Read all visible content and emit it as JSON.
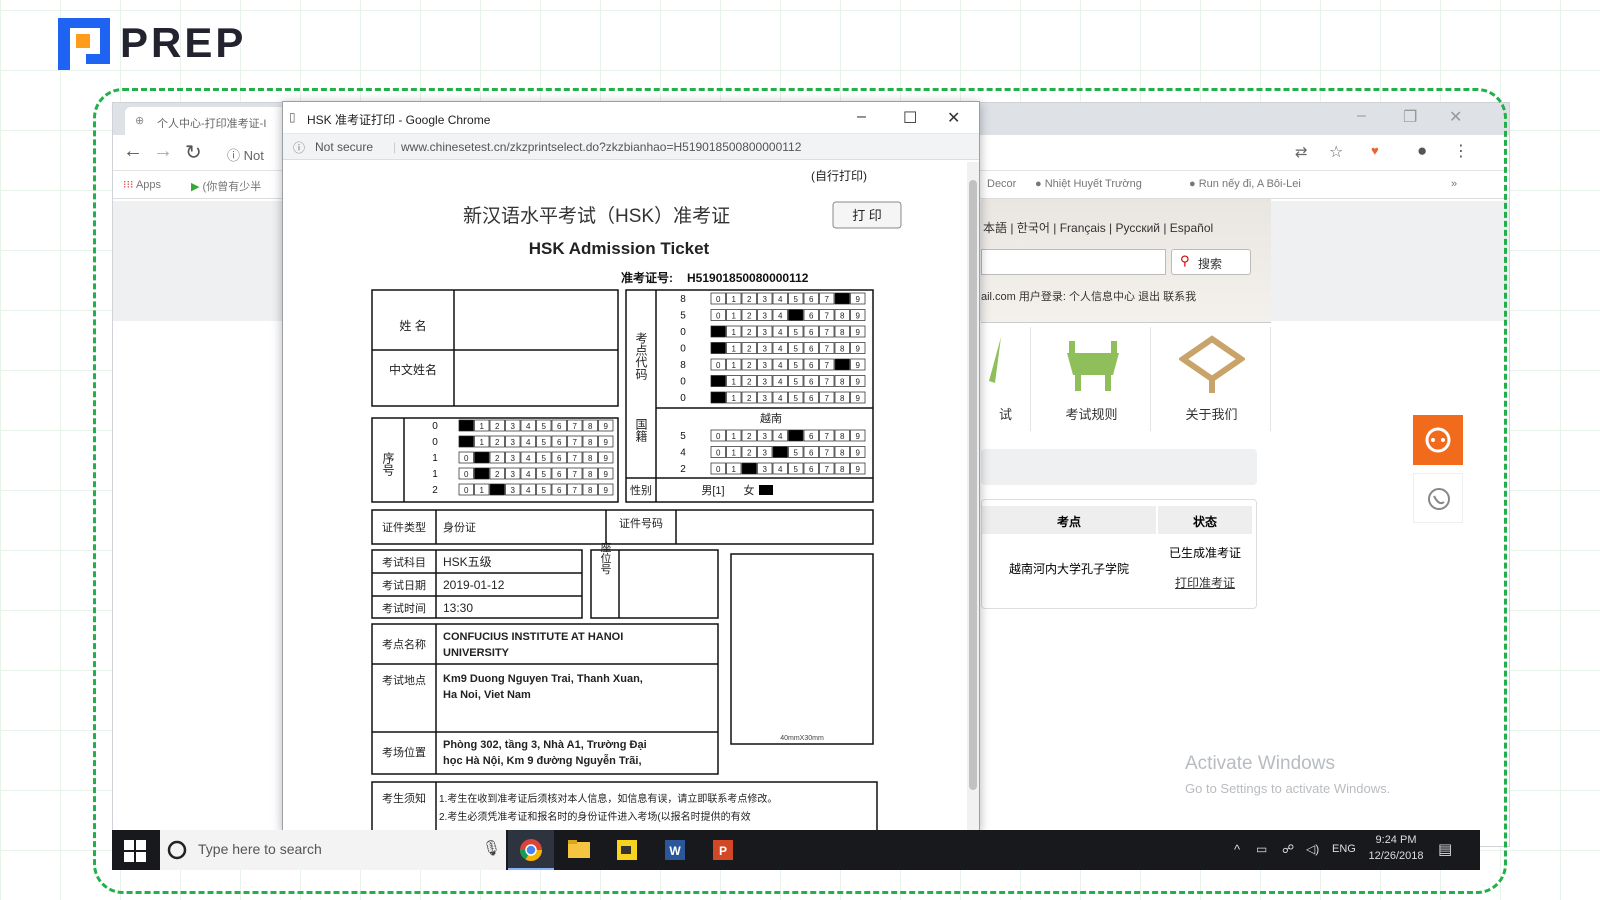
{
  "brand": {
    "name": "PREP",
    "colors": {
      "brand_blue": "#1f63f2",
      "brand_orange": "#ff9c1a",
      "dashed_green": "#22b04a"
    }
  },
  "bg_browser": {
    "tab_title": "个人中心-打印准考证-I",
    "address_text": "Not",
    "bookmarks": [
      "Apps",
      "(你曾有少半",
      "Decor",
      "Nhiệt Huyết Trường",
      "Run nếy đi, A Bôi-Lei"
    ],
    "languages": "本語 | 한국어 | Français | Русский | Español",
    "search_label": "搜索",
    "user_bar": "ail.com  用户登录: 个人信息中心  退出  联系我",
    "nav_tiles": [
      "试",
      "考试规则",
      "关于我们"
    ],
    "table_headers": [
      "考点",
      "状态"
    ],
    "table_row": {
      "center": "越南河内大学孔子学院",
      "status": "已生成准考证",
      "action": "打印准考证"
    },
    "activate_title": "Activate Windows",
    "activate_sub": "Go to Settings to activate Windows."
  },
  "popup": {
    "window_title": "HSK 准考证打印 - Google Chrome",
    "security": "Not secure",
    "url": "www.chinesetest.cn/zkzprintselect.do?zkzbianhao=H519018500800000112"
  },
  "ticket": {
    "self_print": "(自行打印)",
    "title_cn": "新汉语水平考试（HSK）准考证",
    "print_button": "打 印",
    "title_en": "HSK Admission Ticket",
    "number_label": "准考证号:",
    "number": "H51901850080000112",
    "name_label": "姓  名",
    "cn_name_label": "中文姓名",
    "seq_label": "序号",
    "seq_digits": [
      "0",
      "0",
      "1",
      "1",
      "2"
    ],
    "seq_marked": [
      0,
      0,
      1,
      1,
      2
    ],
    "center_code_label": "考点代码",
    "center_digits": [
      "8",
      "5",
      "0",
      "0",
      "8",
      "0",
      "0"
    ],
    "center_marked": [
      8,
      5,
      0,
      0,
      8,
      0,
      0
    ],
    "nationality_label": "国籍",
    "nationality": "越南",
    "nat_digits": [
      "5",
      "4",
      "2"
    ],
    "nat_marked": [
      5,
      4,
      2
    ],
    "gender_label": "性别",
    "gender_male": "男[1]",
    "gender_female": "女",
    "id_type_label": "证件类型",
    "id_type": "身份证",
    "id_number_label": "证件号码",
    "exam_subject_label": "考试科目",
    "exam_subject": "HSK五级",
    "exam_date_label": "考试日期",
    "exam_date": "2019-01-12",
    "exam_time_label": "考试时间",
    "exam_time": "13:30",
    "seat_label": "座位号",
    "photo_note": "40mmX30mm",
    "center_name_label": "考点名称",
    "center_name_line1": "CONFUCIUS INSTITUTE AT HANOI",
    "center_name_line2": "UNIVERSITY",
    "address_label": "考试地点",
    "address_line1": "Km9 Duong Nguyen Trai, Thanh Xuan,",
    "address_line2": "Ha Noi, Viet Nam",
    "room_label": "考场位置",
    "room_line1": "Phòng 302, tầng 3, Nhà A1, Trường Đại",
    "room_line2": "học Hà Nội, Km 9 đường Nguyễn Trãi,",
    "notes_label": "考生须知",
    "notes_line1": "1.考生在收到准考证后须核对本人信息，如信息有误，请立即联系考点修改。",
    "notes_line2": "2.考生必须凭准考证和报名时的身份证件进入考场(以报名时提供的有效"
  },
  "taskbar": {
    "search_placeholder": "Type here to search",
    "apps": [
      "chrome",
      "file-explorer",
      "sticky-notes",
      "word",
      "powerpoint"
    ],
    "lang": "ENG",
    "time": "9:24 PM",
    "date": "12/26/2018"
  }
}
